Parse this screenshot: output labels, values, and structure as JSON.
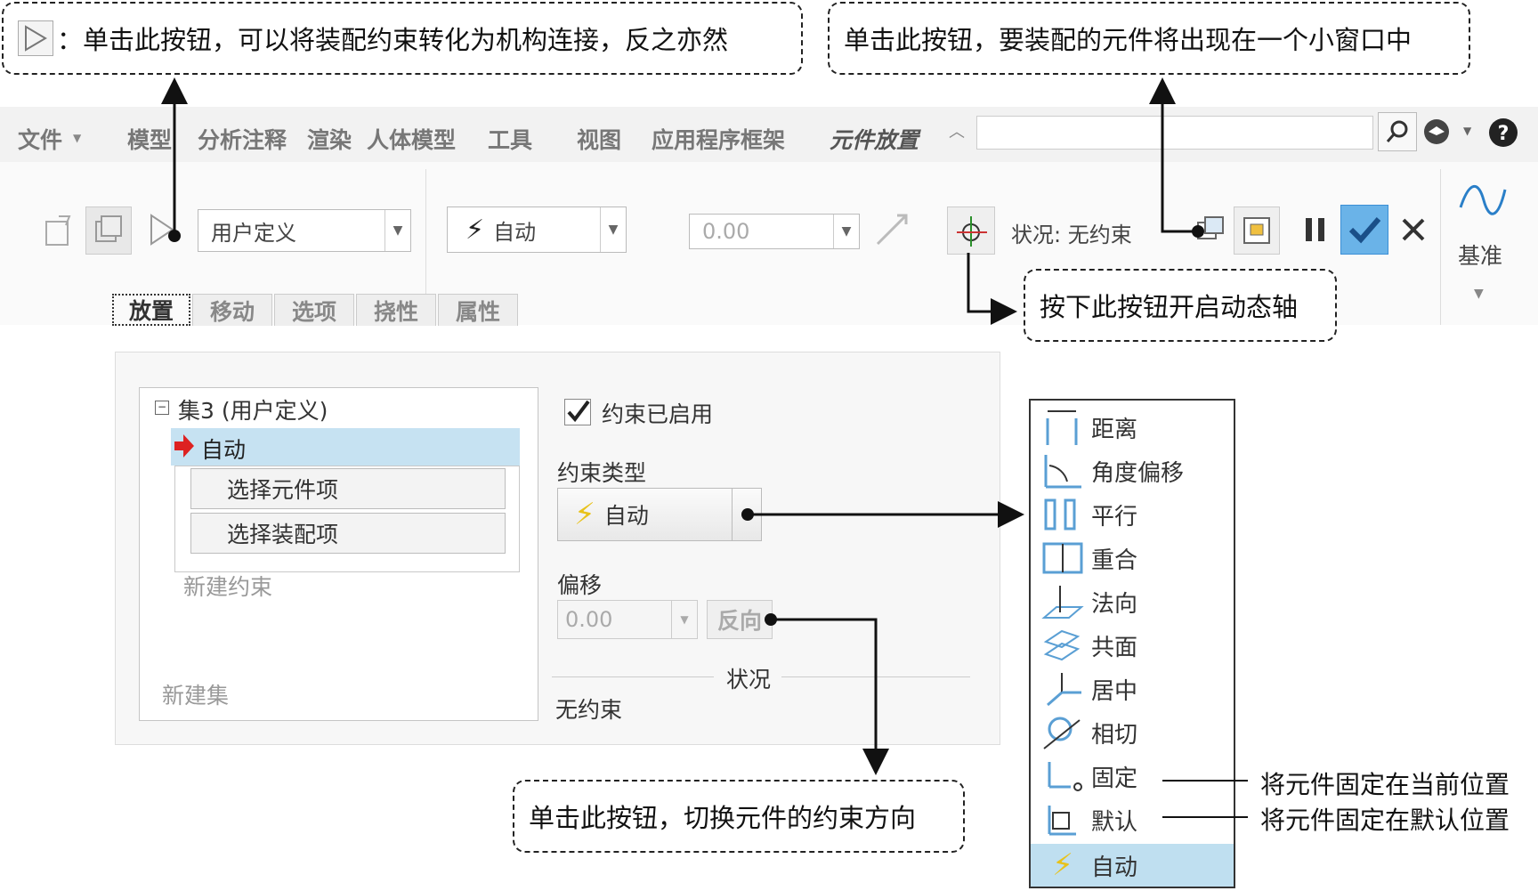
{
  "callouts": {
    "top_left": "：单击此按钮，可以将装配约束转化为机构连接，反之亦然",
    "top_right": "单击此按钮，要装配的元件将出现在一个小窗口中",
    "dynamic_axis": "按下此按钮开启动态轴",
    "flip": "单击此按钮，切换元件的约束方向"
  },
  "ribbon": {
    "tabs": [
      "文件",
      "模型",
      "分析注释",
      "渲染",
      "人体模型",
      "工具",
      "视图",
      "应用程序框架"
    ],
    "active_tab": "元件放置",
    "user_defined": "用户定义",
    "constraint_type": "自动",
    "offset_value": "0.00",
    "status": "状况: 无约束",
    "datum_label": "基准",
    "subtabs": [
      "放置",
      "移动",
      "选项",
      "挠性",
      "属性"
    ]
  },
  "panel": {
    "set_label": "集3 (用户定义)",
    "auto_item": "自动",
    "select_component": "选择元件项",
    "select_assembly": "选择装配项",
    "new_constraint": "新建约束",
    "new_set": "新建集",
    "constraint_enabled": "约束已启用",
    "constraint_type_label": "约束类型",
    "constraint_type_value": "自动",
    "offset_label": "偏移",
    "offset_value": "0.00",
    "flip_button": "反向",
    "status_heading": "状况",
    "status_value": "无约束"
  },
  "menu": {
    "items": [
      "距离",
      "角度偏移",
      "平行",
      "重合",
      "法向",
      "共面",
      "居中",
      "相切",
      "固定",
      "默认",
      "自动"
    ],
    "selected": "自动"
  },
  "notes": {
    "fix_current": "将元件固定在当前位置",
    "fix_default": "将元件固定在默认位置"
  },
  "colors": {
    "accent": "#3c8fd6",
    "selection": "#bfdff0",
    "auto_icon": "#e8c21a"
  }
}
